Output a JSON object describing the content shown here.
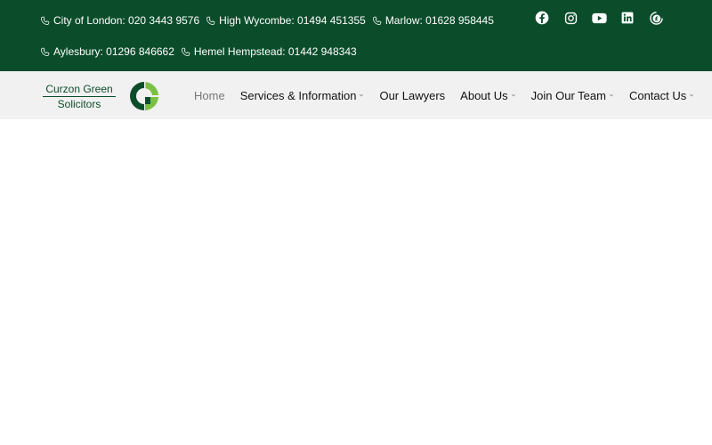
{
  "topbar": {
    "phones_row1": [
      {
        "label": "City of London: 020 3443 9576"
      },
      {
        "label": "High Wycombe: 01494 451355"
      },
      {
        "label": "Marlow: 01628 958445"
      }
    ],
    "phones_row2": [
      {
        "label": "Aylesbury: 01296 846662"
      },
      {
        "label": "Hemel Hempstead: 01442 948343"
      }
    ],
    "socials": [
      "facebook-icon",
      "instagram-icon",
      "youtube-icon",
      "linkedin-icon",
      "pound-coin-icon"
    ]
  },
  "logo": {
    "line1": "Curzon Green",
    "line2": "Solicitors"
  },
  "nav": {
    "items": [
      {
        "label": "Home",
        "active": true,
        "dropdown": false
      },
      {
        "label": "Services & Information",
        "active": false,
        "dropdown": true
      },
      {
        "label": "Our Lawyers",
        "active": false,
        "dropdown": false
      },
      {
        "label": "About Us",
        "active": false,
        "dropdown": true
      },
      {
        "label": "Join Our Team",
        "active": false,
        "dropdown": true
      },
      {
        "label": "Contact Us",
        "active": false,
        "dropdown": true
      }
    ]
  },
  "colors": {
    "brand_dark_green": "#0b4d2b",
    "brand_light_green": "#7ac143",
    "nav_background": "#f1f1f1"
  }
}
